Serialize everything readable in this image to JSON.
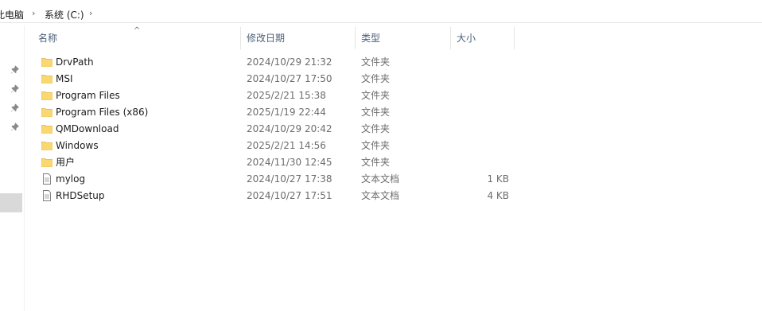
{
  "breadcrumb": {
    "items": [
      "此电脑",
      "系统 (C:)"
    ]
  },
  "columns": {
    "name": "名称",
    "modified": "修改日期",
    "type": "类型",
    "size": "大小"
  },
  "files": [
    {
      "name": "DrvPath",
      "modified": "2024/10/29 21:32",
      "type": "文件夹",
      "size": "",
      "icon": "folder-icon"
    },
    {
      "name": "MSI",
      "modified": "2024/10/27 17:50",
      "type": "文件夹",
      "size": "",
      "icon": "folder-icon"
    },
    {
      "name": "Program Files",
      "modified": "2025/2/21 15:38",
      "type": "文件夹",
      "size": "",
      "icon": "folder-icon"
    },
    {
      "name": "Program Files (x86)",
      "modified": "2025/1/19 22:44",
      "type": "文件夹",
      "size": "",
      "icon": "folder-icon"
    },
    {
      "name": "QMDownload",
      "modified": "2024/10/29 20:42",
      "type": "文件夹",
      "size": "",
      "icon": "folder-icon"
    },
    {
      "name": "Windows",
      "modified": "2025/2/21 14:56",
      "type": "文件夹",
      "size": "",
      "icon": "folder-icon"
    },
    {
      "name": "用户",
      "modified": "2024/11/30 12:45",
      "type": "文件夹",
      "size": "",
      "icon": "folder-icon"
    },
    {
      "name": "mylog",
      "modified": "2024/10/27 17:38",
      "type": "文本文档",
      "size": "1 KB",
      "icon": "text-file-icon"
    },
    {
      "name": "RHDSetup",
      "modified": "2024/10/27 17:51",
      "type": "文本文档",
      "size": "4 KB",
      "icon": "text-file-icon"
    }
  ],
  "colors": {
    "folder": "#f8d775",
    "folder_dark": "#e8b84a",
    "header_text": "#4c607a",
    "muted_text": "#6d6d6d"
  }
}
